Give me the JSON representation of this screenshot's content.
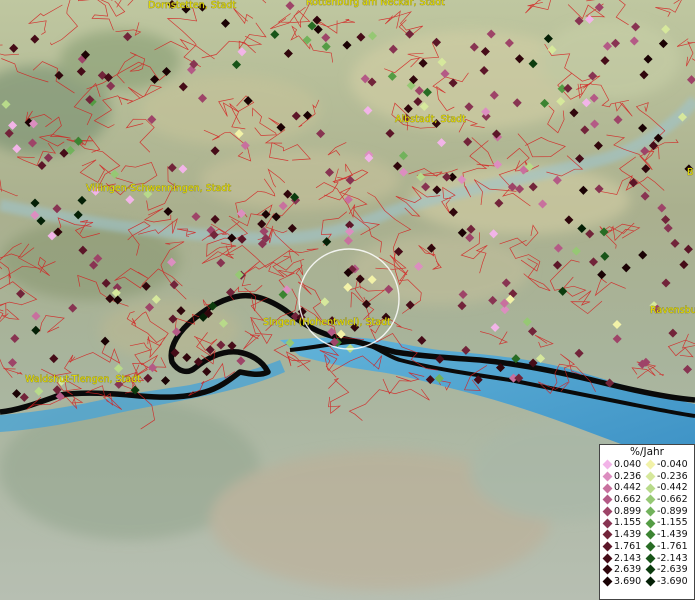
{
  "map": {
    "city_labels": [
      {
        "id": "dornstetten",
        "text": "Dornstetten, Stadt"
      },
      {
        "id": "rottenburg",
        "text": "Rottenburg am Neckar, Stadt"
      },
      {
        "id": "albstadt",
        "text": "Albstadt, Stadt"
      },
      {
        "id": "villingen",
        "text": "Villingen-Schwenningen, Stadt"
      },
      {
        "id": "singen",
        "text": "Singen (Hohentwiel), Stadt"
      },
      {
        "id": "waldshut",
        "text": "Waldshut-Tiengen, Stadt"
      },
      {
        "id": "ravensburg",
        "text": "Ravensbu"
      },
      {
        "id": "b_edge",
        "text": "B"
      }
    ],
    "colors": {
      "boundary": "#d42020",
      "water": "#4fa9d8",
      "shore": "#0a0a0a",
      "label": "#e8e000"
    }
  },
  "legend": {
    "title": "%/Jahr",
    "positive": [
      {
        "label": "0.040",
        "color": "#f2b4e8"
      },
      {
        "label": "0.236",
        "color": "#dc8ec0"
      },
      {
        "label": "0.442",
        "color": "#c8709e"
      },
      {
        "label": "0.662",
        "color": "#b45a86"
      },
      {
        "label": "0.899",
        "color": "#9e4468"
      },
      {
        "label": "1.155",
        "color": "#883452"
      },
      {
        "label": "1.439",
        "color": "#72243a"
      },
      {
        "label": "1.761",
        "color": "#5c1628"
      },
      {
        "label": "2.143",
        "color": "#460c18"
      },
      {
        "label": "2.639",
        "color": "#30060c"
      },
      {
        "label": "3.690",
        "color": "#1a0204"
      }
    ],
    "negative": [
      {
        "label": "-0.040",
        "color": "#f2f2a8"
      },
      {
        "label": "-0.236",
        "color": "#d6e89c"
      },
      {
        "label": "-0.442",
        "color": "#b8da8a"
      },
      {
        "label": "-0.662",
        "color": "#96c874"
      },
      {
        "label": "-0.899",
        "color": "#72b25c"
      },
      {
        "label": "-1.155",
        "color": "#549c44"
      },
      {
        "label": "-1.439",
        "color": "#3c8432"
      },
      {
        "label": "-1.761",
        "color": "#286c24"
      },
      {
        "label": "-2.143",
        "color": "#185418"
      },
      {
        "label": "-2.639",
        "color": "#0c3c0e"
      },
      {
        "label": "-3.690",
        "color": "#042006"
      }
    ]
  }
}
